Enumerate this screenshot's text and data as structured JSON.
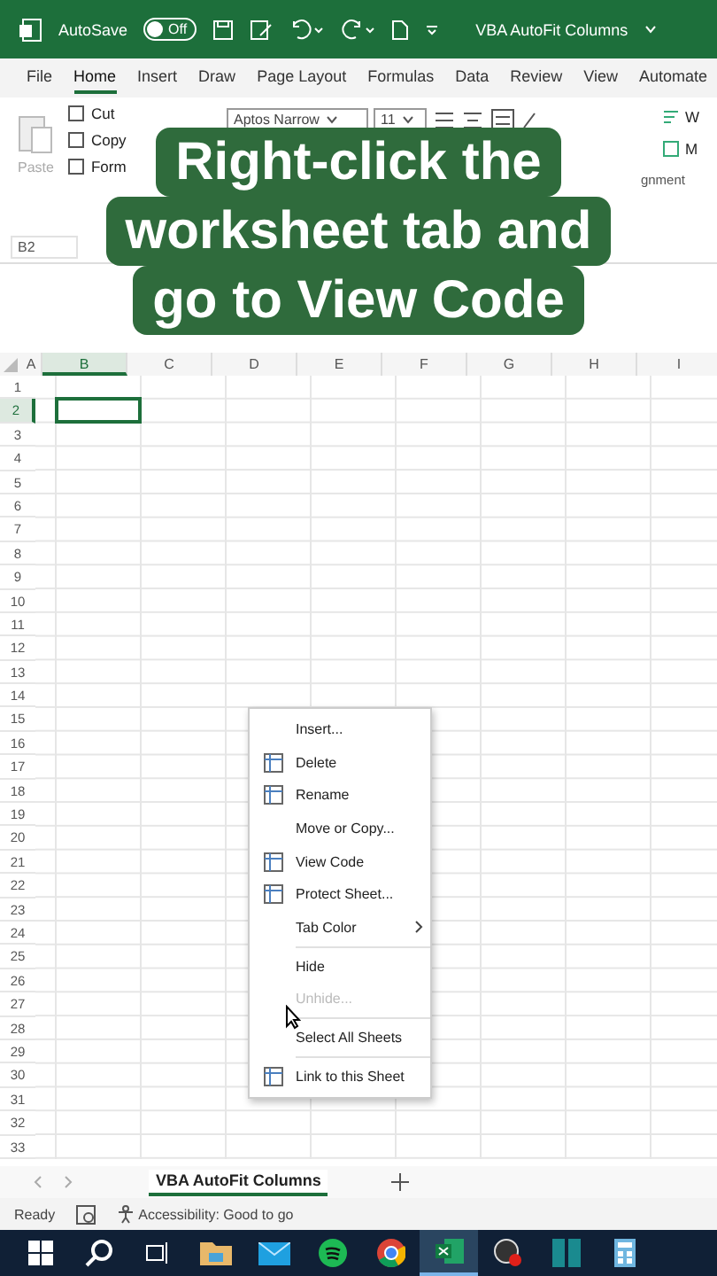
{
  "title_bar": {
    "autosave_label": "AutoSave",
    "autosave_toggle": {
      "label": "Off",
      "on": false
    },
    "document_title": "VBA AutoFit Columns"
  },
  "ribbon_tabs": [
    {
      "label": "File",
      "selected": false
    },
    {
      "label": "Home",
      "selected": true
    },
    {
      "label": "Insert",
      "selected": false
    },
    {
      "label": "Draw",
      "selected": false
    },
    {
      "label": "Page Layout",
      "selected": false
    },
    {
      "label": "Formulas",
      "selected": false
    },
    {
      "label": "Data",
      "selected": false
    },
    {
      "label": "Review",
      "selected": false
    },
    {
      "label": "View",
      "selected": false
    },
    {
      "label": "Automate",
      "selected": false
    }
  ],
  "ribbon": {
    "paste_label": "Paste",
    "clipboard_items": [
      "Cut",
      "Copy",
      "Form"
    ],
    "font_name": "Aptos Narrow",
    "font_size": "11",
    "wrap_label": "W",
    "merge_label": "M",
    "group_label": "gnment"
  },
  "name_box": "B2",
  "caption_lines": [
    "Right-click the",
    "worksheet tab and",
    "go to View Code"
  ],
  "columns": [
    {
      "label": "A",
      "selected": false
    },
    {
      "label": "B",
      "selected": true
    },
    {
      "label": "C",
      "selected": false
    },
    {
      "label": "D",
      "selected": false
    },
    {
      "label": "E",
      "selected": false
    },
    {
      "label": "F",
      "selected": false
    },
    {
      "label": "G",
      "selected": false
    },
    {
      "label": "H",
      "selected": false
    },
    {
      "label": "I",
      "selected": false
    }
  ],
  "rows": [
    {
      "label": "1",
      "selected": false
    },
    {
      "label": "2",
      "selected": true
    },
    {
      "label": "3",
      "selected": false
    },
    {
      "label": "4",
      "selected": false
    },
    {
      "label": "5",
      "selected": false
    },
    {
      "label": "6",
      "selected": false
    },
    {
      "label": "7",
      "selected": false
    },
    {
      "label": "8",
      "selected": false
    },
    {
      "label": "9",
      "selected": false
    },
    {
      "label": "10",
      "selected": false
    },
    {
      "label": "11",
      "selected": false
    },
    {
      "label": "12",
      "selected": false
    },
    {
      "label": "13",
      "selected": false
    },
    {
      "label": "14",
      "selected": false
    },
    {
      "label": "15",
      "selected": false
    },
    {
      "label": "16",
      "selected": false
    },
    {
      "label": "17",
      "selected": false
    },
    {
      "label": "18",
      "selected": false
    },
    {
      "label": "19",
      "selected": false
    },
    {
      "label": "20",
      "selected": false
    },
    {
      "label": "21",
      "selected": false
    },
    {
      "label": "22",
      "selected": false
    },
    {
      "label": "23",
      "selected": false
    },
    {
      "label": "24",
      "selected": false
    },
    {
      "label": "25",
      "selected": false
    },
    {
      "label": "26",
      "selected": false
    },
    {
      "label": "27",
      "selected": false
    },
    {
      "label": "28",
      "selected": false
    },
    {
      "label": "29",
      "selected": false
    },
    {
      "label": "30",
      "selected": false
    },
    {
      "label": "31",
      "selected": false
    },
    {
      "label": "32",
      "selected": false
    },
    {
      "label": "33",
      "selected": false
    }
  ],
  "context_menu": [
    {
      "kind": "item",
      "label": "Insert...",
      "icon": false,
      "disabled": false,
      "submenu": false
    },
    {
      "kind": "item",
      "label": "Delete",
      "icon": true,
      "disabled": false,
      "submenu": false
    },
    {
      "kind": "item",
      "label": "Rename",
      "icon": true,
      "disabled": false,
      "submenu": false
    },
    {
      "kind": "item",
      "label": "Move or Copy...",
      "icon": false,
      "disabled": false,
      "submenu": false
    },
    {
      "kind": "item",
      "label": "View Code",
      "icon": true,
      "disabled": false,
      "submenu": false
    },
    {
      "kind": "item",
      "label": "Protect Sheet...",
      "icon": true,
      "disabled": false,
      "submenu": false
    },
    {
      "kind": "item",
      "label": "Tab Color",
      "icon": false,
      "disabled": false,
      "submenu": true
    },
    {
      "kind": "separator"
    },
    {
      "kind": "item",
      "label": "Hide",
      "icon": false,
      "disabled": false,
      "submenu": false
    },
    {
      "kind": "item",
      "label": "Unhide...",
      "icon": false,
      "disabled": true,
      "submenu": false
    },
    {
      "kind": "separator"
    },
    {
      "kind": "item",
      "label": "Select All Sheets",
      "icon": false,
      "disabled": false,
      "submenu": false
    },
    {
      "kind": "separator"
    },
    {
      "kind": "item",
      "label": "Link to this Sheet",
      "icon": true,
      "disabled": false,
      "submenu": false
    }
  ],
  "sheet_tabs": [
    {
      "label": "VBA AutoFit Columns",
      "selected": true
    }
  ],
  "status_bar": {
    "mode": "Ready",
    "accessibility": "Accessibility: Good to go"
  },
  "taskbar": [
    {
      "kind": "start",
      "selected": false
    },
    {
      "kind": "search",
      "selected": false
    },
    {
      "kind": "taskview",
      "selected": false
    },
    {
      "kind": "folder",
      "selected": false
    },
    {
      "kind": "mail",
      "selected": false
    },
    {
      "kind": "music",
      "selected": false
    },
    {
      "kind": "browser",
      "selected": false
    },
    {
      "kind": "excel",
      "selected": true
    },
    {
      "kind": "recorder",
      "selected": false
    },
    {
      "kind": "panel",
      "selected": false
    },
    {
      "kind": "calculator",
      "selected": false
    }
  ]
}
